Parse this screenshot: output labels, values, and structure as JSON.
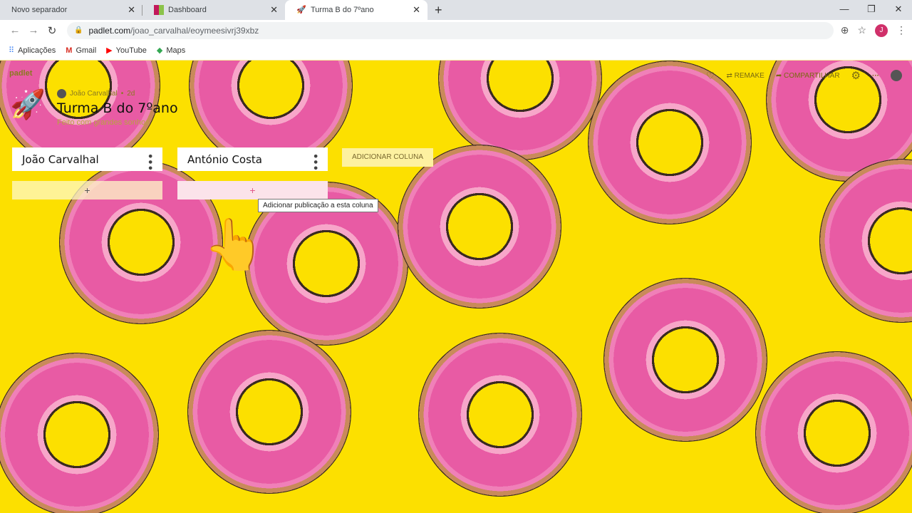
{
  "browser": {
    "tabs": [
      {
        "label": "Novo separador",
        "active": false
      },
      {
        "label": "Dashboard",
        "active": false
      },
      {
        "label": "Turma B do 7ºano",
        "active": true
      }
    ],
    "url_host": "padlet.com",
    "url_path": "/joao_carvalhal/eoymeesivrj39xbz",
    "profile_initial": "J",
    "bookmarks": [
      {
        "label": "Aplicações",
        "icon": "apps-grid-icon"
      },
      {
        "label": "Gmail",
        "icon": "gmail-icon"
      },
      {
        "label": "YouTube",
        "icon": "youtube-icon"
      },
      {
        "label": "Maps",
        "icon": "maps-icon"
      }
    ]
  },
  "padlet": {
    "logo": "padlet",
    "author": "João Carvalhal",
    "age": "2d",
    "title": "Turma B do 7ºano",
    "subtitle": "Feito com grandes sonhos",
    "actions": {
      "remake": "REMAKE",
      "share": "COMPARTILHAR"
    },
    "columns": [
      {
        "title": "João Carvalhal"
      },
      {
        "title": "António Costa"
      }
    ],
    "add_column": "ADICIONAR COLUNA",
    "add_post_symbol": "+",
    "tooltip": "Adicionar publicação a esta coluna"
  },
  "colors": {
    "background": "#fce000",
    "donut": "#e85ba4"
  }
}
